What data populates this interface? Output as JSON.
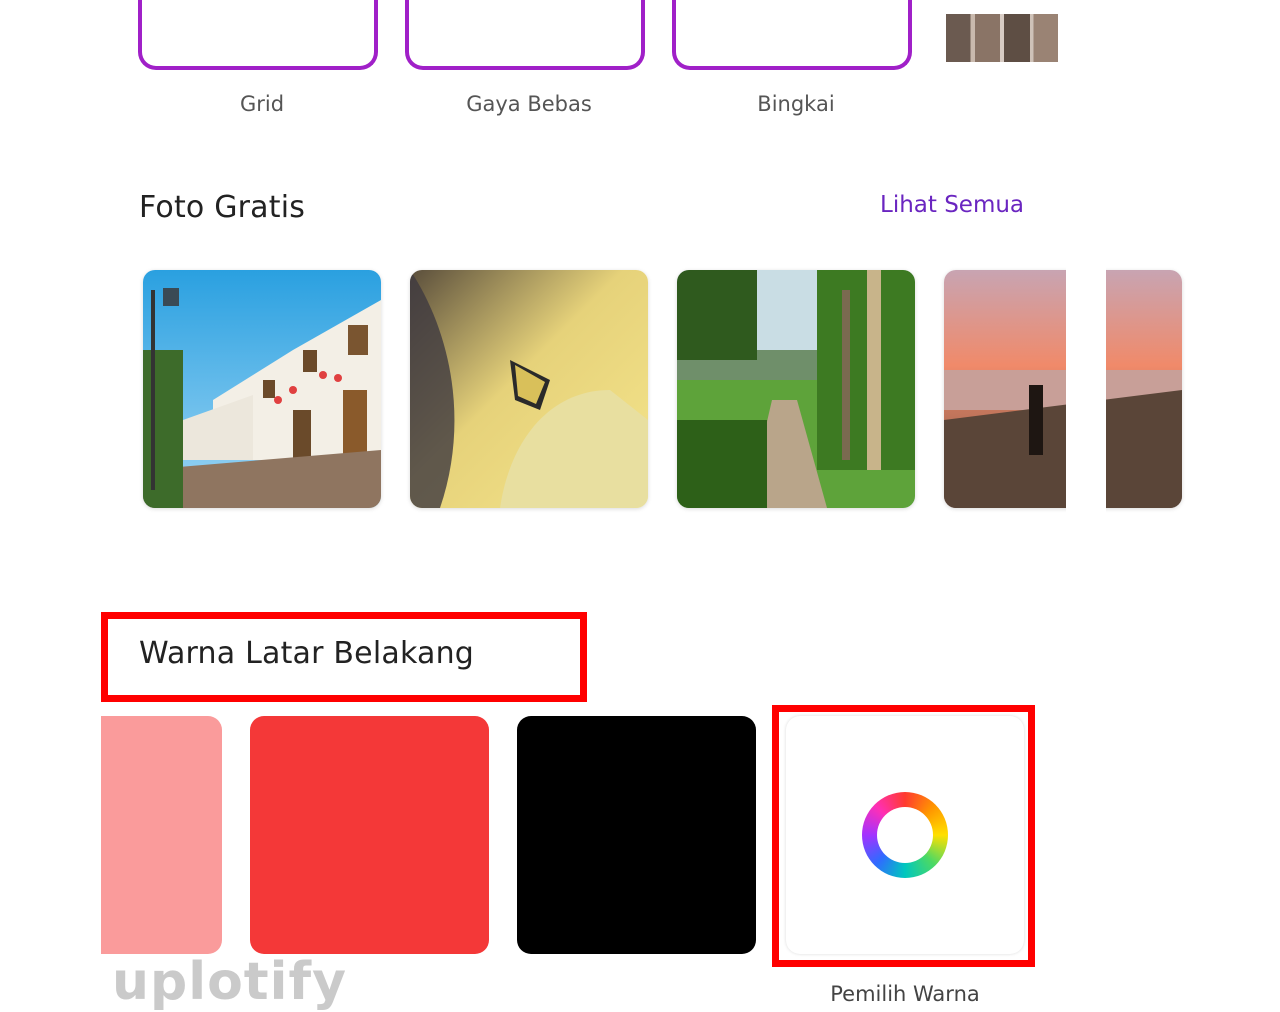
{
  "layouts": {
    "items": [
      {
        "label": "Grid"
      },
      {
        "label": "Gaya Bebas"
      },
      {
        "label": "Bingkai"
      }
    ],
    "accent_color": "#a020c8"
  },
  "free_photos": {
    "title": "Foto Gratis",
    "see_all_label": "Lihat Semua",
    "see_all_color": "#6a25c0",
    "photos": [
      {
        "subject": "village street"
      },
      {
        "subject": "butterfly"
      },
      {
        "subject": "forest path"
      },
      {
        "subject": "beach sunset"
      }
    ]
  },
  "background_color": {
    "title": "Warna Latar Belakang",
    "swatches": [
      "#fa9b9b",
      "#f43838",
      "#000000"
    ],
    "picker_label": "Pemilih Warna",
    "picker_icon": "color-wheel-icon"
  },
  "highlight_color": "#ff0000",
  "watermark": "uplotify"
}
